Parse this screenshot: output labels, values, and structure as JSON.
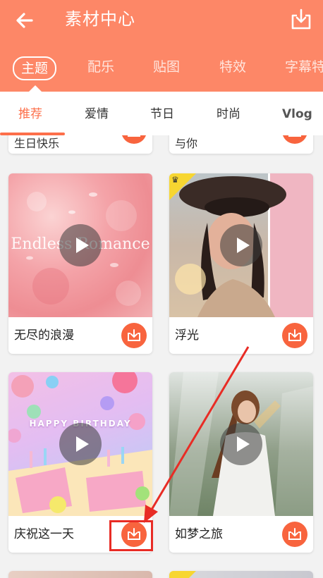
{
  "header": {
    "title": "素材中心"
  },
  "categories": [
    {
      "label": "主题",
      "active": true
    },
    {
      "label": "配乐",
      "active": false
    },
    {
      "label": "贴图",
      "active": false
    },
    {
      "label": "特效",
      "active": false
    },
    {
      "label": "字幕特",
      "active": false
    }
  ],
  "sub_tabs": [
    {
      "label": "推荐",
      "active": true
    },
    {
      "label": "爱情",
      "active": false
    },
    {
      "label": "节日",
      "active": false
    },
    {
      "label": "时尚",
      "active": false
    },
    {
      "label": "Vlog",
      "active": false
    }
  ],
  "partial_cards": [
    {
      "title": "生日快乐"
    },
    {
      "title": "与你"
    }
  ],
  "cards": [
    {
      "title": "无尽的浪漫",
      "overlay_text": "Endless Romance",
      "premium": false
    },
    {
      "title": "浮光",
      "premium": true
    },
    {
      "title": "庆祝这一天",
      "overlay_text": "HAPPY BIRTHDAY",
      "premium": false
    },
    {
      "title": "如梦之旅",
      "premium": false
    }
  ],
  "colors": {
    "header": "#fd8767",
    "accent": "#f8643e",
    "annotation": "#e82c25"
  }
}
